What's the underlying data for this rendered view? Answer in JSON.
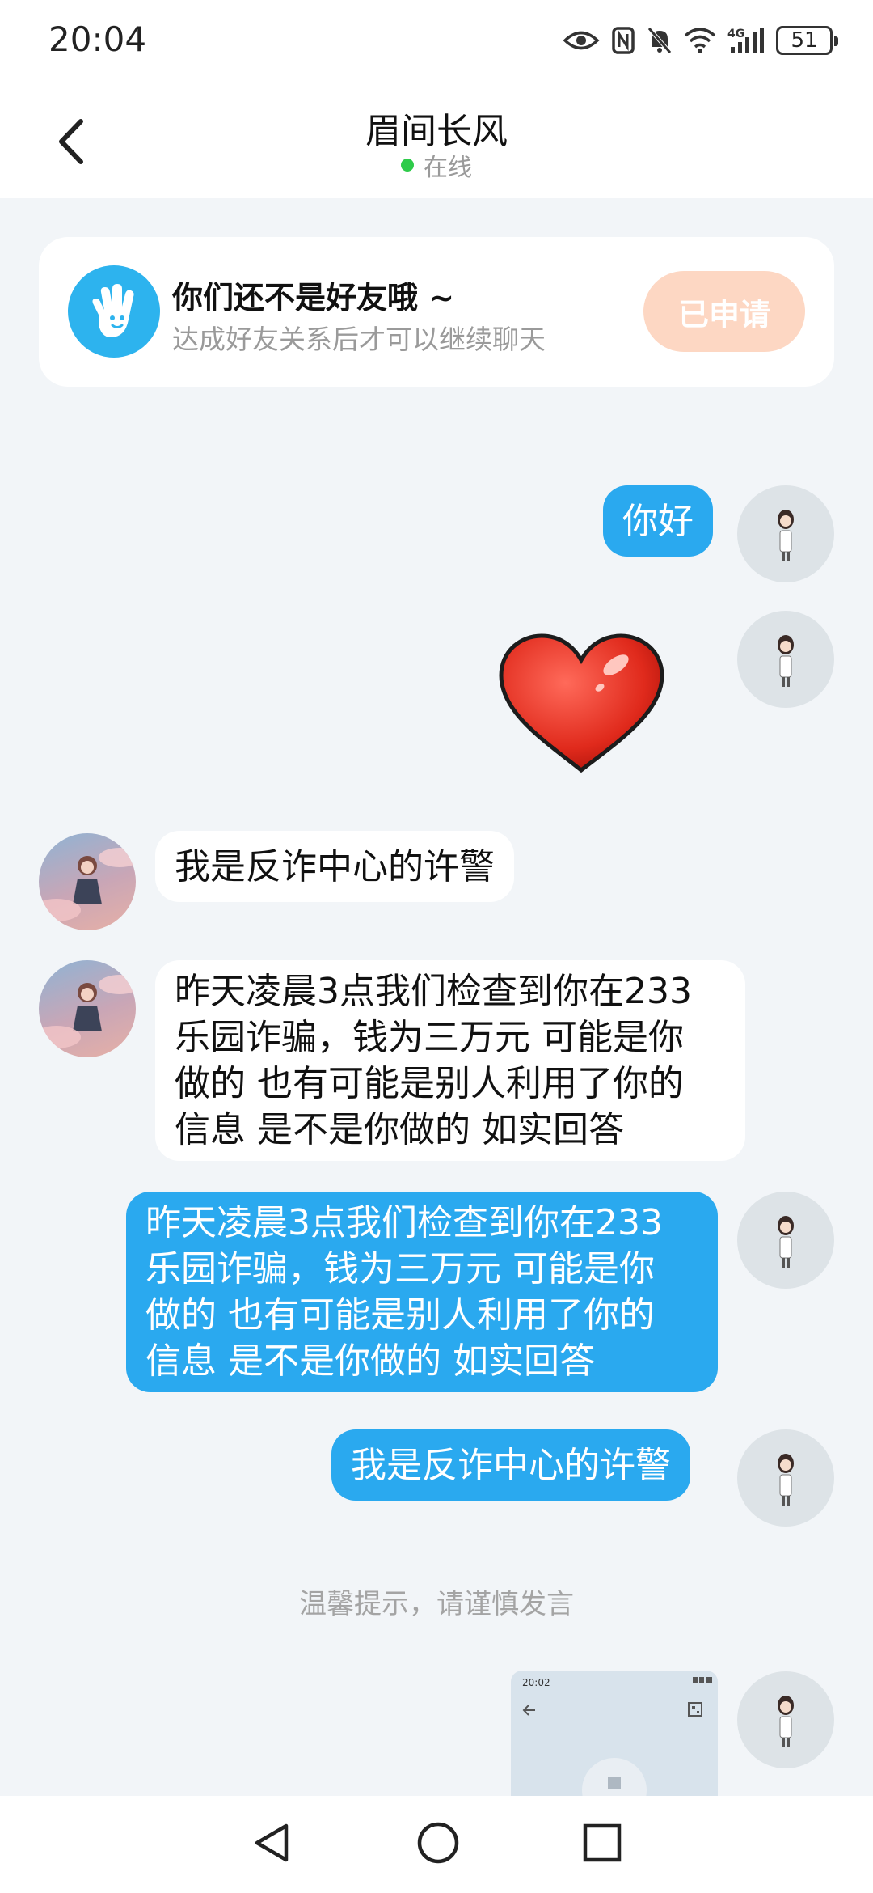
{
  "status_bar": {
    "time": "20:04",
    "battery": "51"
  },
  "header": {
    "name": "眉间长风",
    "status": "在线"
  },
  "friend_card": {
    "title": "你们还不是好友哦 ~",
    "subtitle": "达成好友关系后才可以继续聊天",
    "button": "已申请"
  },
  "messages": [
    {
      "side": "sent",
      "lines": [
        "你好"
      ]
    },
    {
      "side": "sent",
      "sticker": "heart"
    },
    {
      "side": "received",
      "lines": [
        "我是反诈中心的许警"
      ]
    },
    {
      "side": "received",
      "lines": [
        "昨天凌晨3点我们检查到你在233",
        "乐园诈骗，钱为三万元 可能是你",
        "做的 也有可能是别人利用了你的",
        "信息 是不是你做的 如实回答"
      ]
    },
    {
      "side": "sent",
      "lines": [
        "昨天凌晨3点我们检查到你在233",
        "乐园诈骗，钱为三万元 可能是你",
        "做的 也有可能是别人利用了你的",
        "信息 是不是你做的 如实回答"
      ]
    },
    {
      "side": "sent",
      "lines": [
        "我是反诈中心的许警"
      ]
    },
    {
      "side": "sent",
      "image": "screenshot",
      "image_time": "20:02"
    }
  ],
  "notice": "温馨提示，请谨慎发言",
  "icons": {
    "back": "chevron-left-icon",
    "nav_back": "triangle-back-icon",
    "nav_home": "circle-home-icon",
    "nav_recents": "square-recents-icon"
  },
  "colors": {
    "sent_bubble": "#2aa9ef",
    "received_bubble": "#ffffff",
    "apply_button": "#fdd7c3",
    "online": "#2ecb4a"
  }
}
